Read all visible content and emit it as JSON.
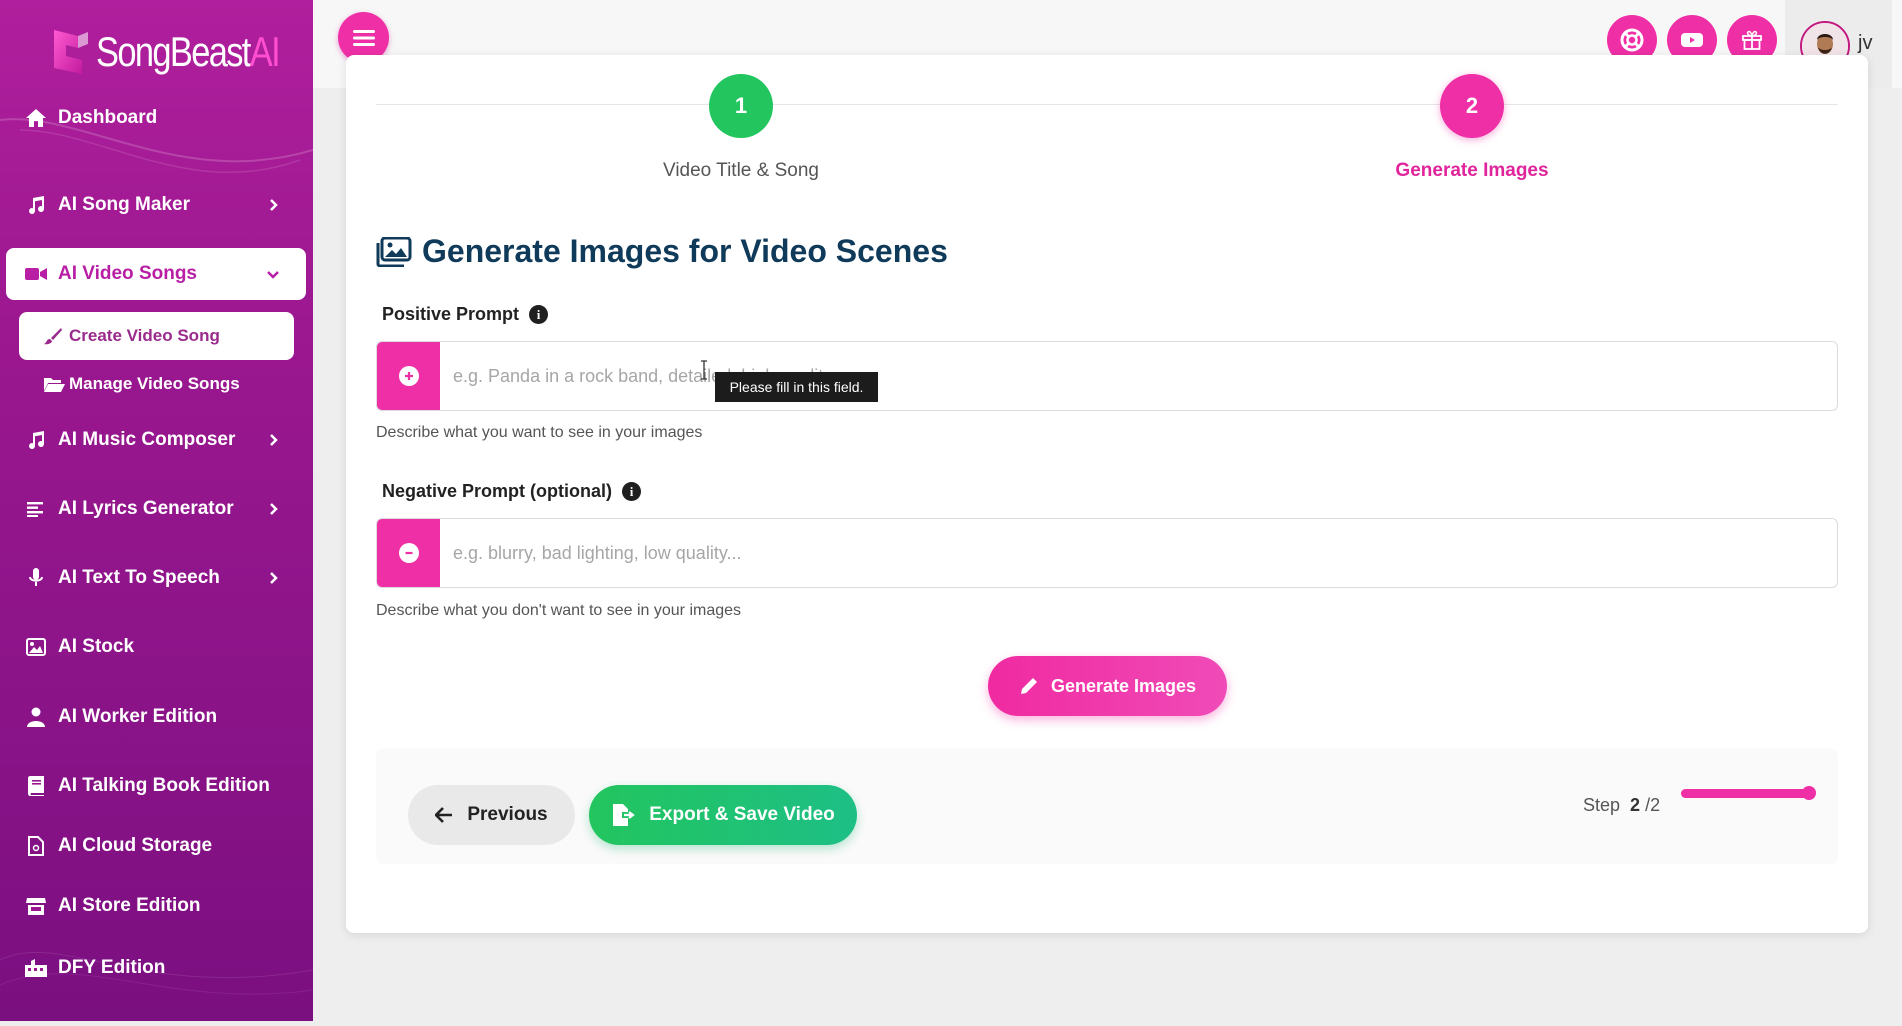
{
  "brand": {
    "name": "SongBeast",
    "suffix": "AI"
  },
  "sidebar": {
    "items": [
      {
        "label": "Dashboard",
        "icon": "home-icon"
      },
      {
        "label": "AI Song Maker",
        "icon": "music-note-icon",
        "has_submenu": true
      },
      {
        "label": "AI Video Songs",
        "icon": "video-camera-icon",
        "has_submenu": true,
        "expanded": true,
        "active": true
      },
      {
        "label": "AI Music Composer",
        "icon": "music-note-icon",
        "has_submenu": true
      },
      {
        "label": "AI Lyrics Generator",
        "icon": "align-left-icon",
        "has_submenu": true
      },
      {
        "label": "AI Text To Speech",
        "icon": "microphone-icon",
        "has_submenu": true
      },
      {
        "label": "AI Stock",
        "icon": "image-icon"
      },
      {
        "label": "AI Worker Edition",
        "icon": "user-icon"
      },
      {
        "label": "AI Talking Book Edition",
        "icon": "book-icon"
      },
      {
        "label": "AI Cloud Storage",
        "icon": "file-icon"
      },
      {
        "label": "AI Store Edition",
        "icon": "store-icon"
      },
      {
        "label": "DFY Edition",
        "icon": "briefcase-icon"
      }
    ],
    "subitems": [
      {
        "label": "Create Video Song",
        "icon": "brush-icon",
        "active": true
      },
      {
        "label": "Manage Video Songs",
        "icon": "folder-open-icon"
      }
    ]
  },
  "header": {
    "icons": [
      "support-lifering-icon",
      "video-icon",
      "gift-icon"
    ],
    "user_name": "jv"
  },
  "wizard": {
    "steps": [
      {
        "number": "1",
        "label": "Video Title & Song",
        "status": "complete",
        "color": "#22c55e"
      },
      {
        "number": "2",
        "label": "Generate Images",
        "status": "current",
        "color": "#ee2fa6"
      }
    ]
  },
  "form": {
    "heading": "Generate Images for Video Scenes",
    "positive": {
      "label": "Positive Prompt",
      "placeholder": "e.g. Panda in a rock band, detailed, high quality...",
      "help": "Describe what you want to see in your images",
      "validation_tooltip": "Please fill in this field."
    },
    "negative": {
      "label": "Negative Prompt (optional)",
      "placeholder": "e.g. blurry, bad lighting, low quality...",
      "help": "Describe what you don't want to see in your images"
    },
    "generate_label": "Generate Images"
  },
  "footer": {
    "previous_label": "Previous",
    "export_label": "Export & Save Video",
    "step_prefix": "Step",
    "step_current": "2",
    "step_total": "/2",
    "progress_percent": 100
  },
  "colors": {
    "accent": "#ee2fa6",
    "success": "#22c55e",
    "heading": "#103a5a"
  }
}
